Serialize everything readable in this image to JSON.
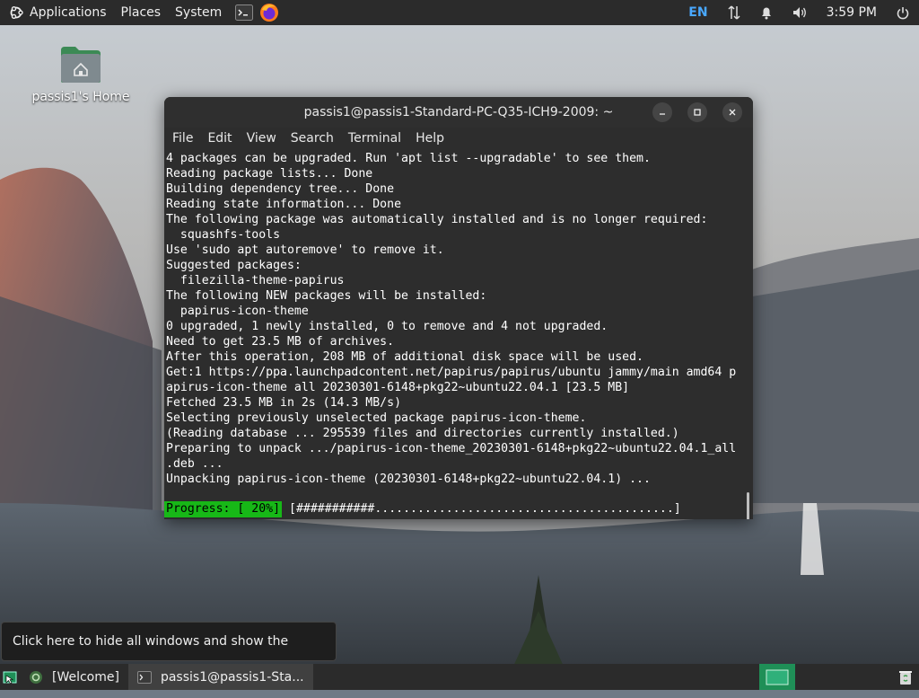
{
  "top_panel": {
    "menus": [
      "Applications",
      "Places",
      "System"
    ],
    "keyboard_layout": "EN",
    "clock": "3:59 PM"
  },
  "desktop": {
    "home_icon_label": "passis1's Home"
  },
  "terminal": {
    "title": "passis1@passis1-Standard-PC-Q35-ICH9-2009: ~",
    "menu": [
      "File",
      "Edit",
      "View",
      "Search",
      "Terminal",
      "Help"
    ],
    "lines": [
      "4 packages can be upgraded. Run 'apt list --upgradable' to see them.",
      "Reading package lists... Done",
      "Building dependency tree... Done",
      "Reading state information... Done",
      "The following package was automatically installed and is no longer required:",
      "  squashfs-tools",
      "Use 'sudo apt autoremove' to remove it.",
      "Suggested packages:",
      "  filezilla-theme-papirus",
      "The following NEW packages will be installed:",
      "  papirus-icon-theme",
      "0 upgraded, 1 newly installed, 0 to remove and 4 not upgraded.",
      "Need to get 23.5 MB of archives.",
      "After this operation, 208 MB of additional disk space will be used.",
      "Get:1 https://ppa.launchpadcontent.net/papirus/papirus/ubuntu jammy/main amd64 p",
      "apirus-icon-theme all 20230301-6148+pkg22~ubuntu22.04.1 [23.5 MB]",
      "Fetched 23.5 MB in 2s (14.3 MB/s)",
      "Selecting previously unselected package papirus-icon-theme.",
      "(Reading database ... 295539 files and directories currently installed.)",
      "Preparing to unpack .../papirus-icon-theme_20230301-6148+pkg22~ubuntu22.04.1_all",
      ".deb ...",
      "Unpacking papirus-icon-theme (20230301-6148+pkg22~ubuntu22.04.1) ...",
      ""
    ],
    "progress_label": "Progress: [ 20%]",
    "progress_bar": "[###########..........................................]",
    "progress_fraction": 0.2
  },
  "tooltip": {
    "text": "Click here to hide all windows and show the desktop."
  },
  "taskbar": {
    "tasks": [
      "[Welcome]",
      "passis1@passis1-Sta..."
    ]
  },
  "colors": {
    "panel_bg": "#2b2b2b",
    "terminal_bg": "#2d2d2d",
    "progress_green": "#17b817",
    "accent_blue": "#49a8ff",
    "workspace_green": "#1f8f57"
  }
}
